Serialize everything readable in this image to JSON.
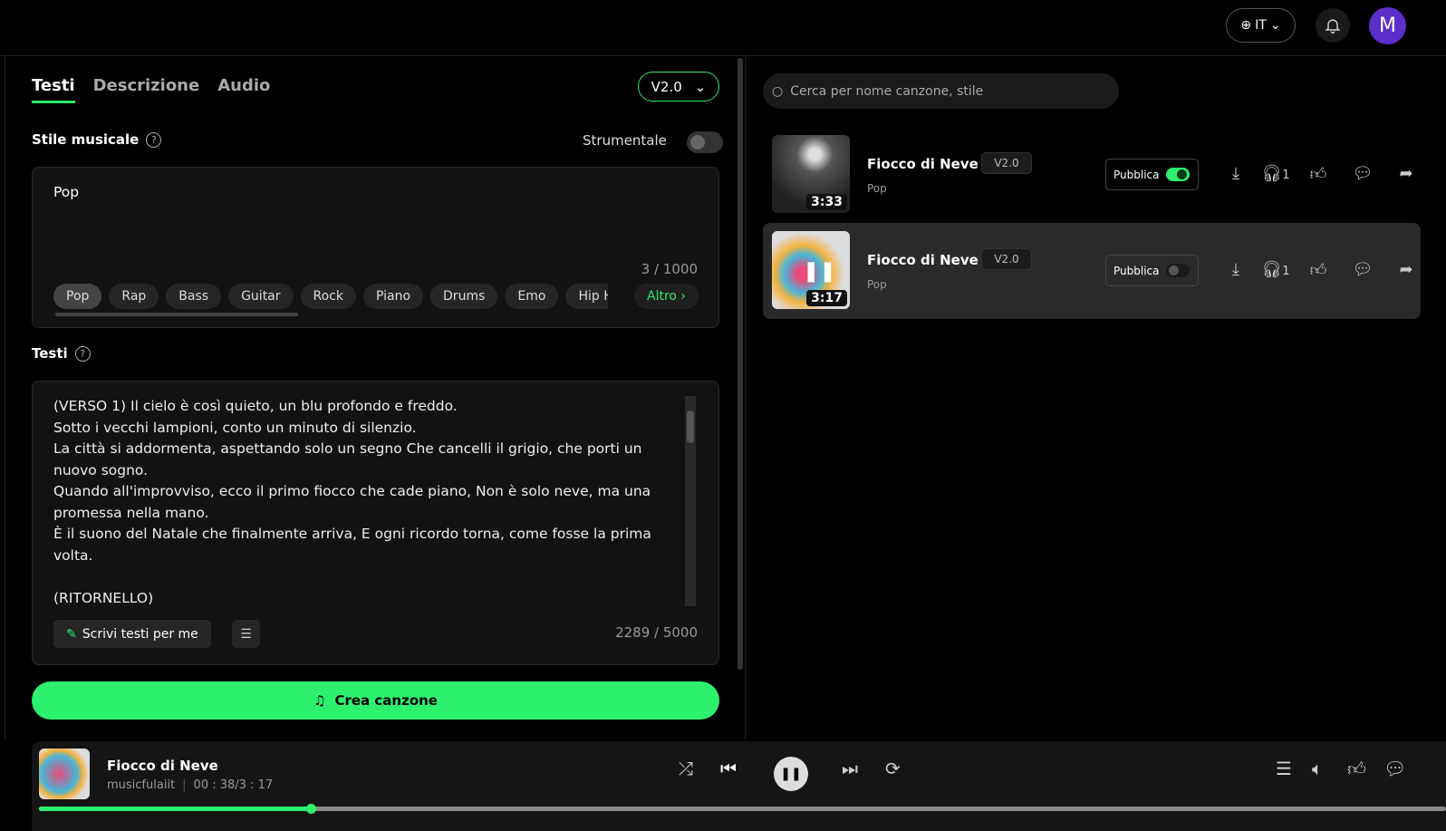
{
  "header": {
    "language": "IT",
    "avatar_letter": "M",
    "language_icon": "globe-icon",
    "notification_icon": "bell-icon"
  },
  "editor": {
    "tabs": [
      "Testi",
      "Descrizione",
      "Audio"
    ],
    "version": "V2.0",
    "style_label": "Stile musicale",
    "instrumental_label": "Strumentale",
    "instrumental_on": false,
    "style_value": "Pop",
    "style_count": "3 / 1000",
    "chips": [
      "Pop",
      "Rap",
      "Bass",
      "Guitar",
      "Rock",
      "Piano",
      "Drums",
      "Emo",
      "Hip Hop"
    ],
    "more_label": "Altro ›",
    "lyrics_label": "Testi",
    "lyrics": "(VERSO 1) Il cielo è così quieto, un blu profondo e freddo.\nSotto i vecchi lampioni, conto un minuto di silenzio.\nLa città si addormenta, aspettando solo un segno Che cancelli il grigio, che porti un nuovo sogno.\nQuando all'improvviso, ecco il primo fiocco che cade piano, Non è solo neve, ma una promessa nella mano.\nÈ il suono del Natale che finalmente arriva, E ogni ricordo torna, come fosse la prima volta.\n\n(RITORNELLO)",
    "write_for_me": "Scrivi testi per me",
    "lyrics_count": "2289 / 5000",
    "create_label": "Crea canzone",
    "accent": "#2ef06f"
  },
  "library": {
    "search_placeholder": "Cerca per nome canzone, stile",
    "songs": [
      {
        "title": "Fiocco di Neve",
        "version": "V2.0",
        "style": "Pop",
        "duration": "3:33",
        "public_label": "Pubblica",
        "public": true,
        "listens": "1"
      },
      {
        "title": "Fiocco di Neve",
        "version": "V2.0",
        "style": "Pop",
        "duration": "3:17",
        "public_label": "Pubblica",
        "public": false,
        "listens": "1"
      }
    ]
  },
  "player": {
    "title": "Fiocco di Neve",
    "artist": "musicfulaiit",
    "time": "00 : 38/3 : 17",
    "progress_percent": 19.3
  }
}
